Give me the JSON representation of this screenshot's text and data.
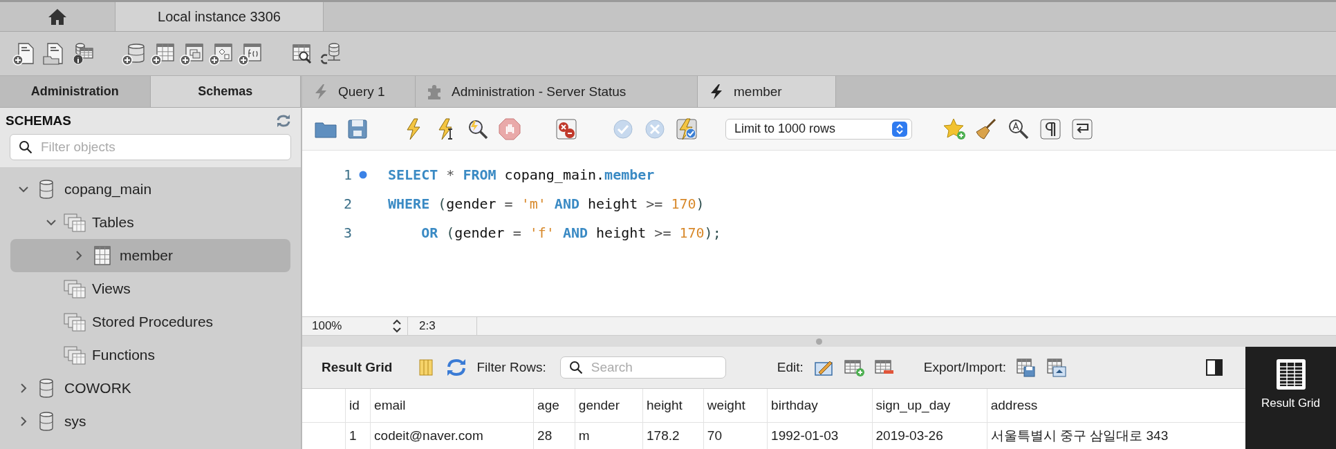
{
  "top_tabs": [
    {
      "kind": "home",
      "selected": false
    },
    {
      "kind": "connection",
      "label": "Local instance 3306",
      "selected": true
    }
  ],
  "sidebar": {
    "tabs": [
      {
        "label": "Administration",
        "selected": false
      },
      {
        "label": "Schemas",
        "selected": true
      }
    ],
    "header": "SCHEMAS",
    "filter": {
      "placeholder": "Filter objects"
    },
    "tree": [
      {
        "kind": "schema",
        "label": "copang_main",
        "expanded": true,
        "selected": false,
        "children": [
          {
            "kind": "folder",
            "label": "Tables",
            "expanded": true,
            "selected": false,
            "children": [
              {
                "kind": "table",
                "label": "member",
                "expanded": false,
                "selected": true
              }
            ]
          },
          {
            "kind": "folder",
            "label": "Views",
            "selected": false
          },
          {
            "kind": "folder",
            "label": "Stored Procedures",
            "selected": false
          },
          {
            "kind": "folder",
            "label": "Functions",
            "selected": false
          }
        ]
      },
      {
        "kind": "schema",
        "label": "COWORK",
        "expanded": false,
        "selected": false
      },
      {
        "kind": "schema",
        "label": "sys",
        "expanded": false,
        "selected": false
      }
    ]
  },
  "editor": {
    "tabs": [
      {
        "kind": "query",
        "label": "Query 1",
        "selected": false
      },
      {
        "kind": "admin",
        "label": "Administration - Server Status",
        "selected": false
      },
      {
        "kind": "query",
        "label": "member",
        "selected": true
      }
    ],
    "limit_select": {
      "value": "Limit to 1000 rows"
    },
    "lines": [
      {
        "number": "1",
        "marker": true,
        "tokens": [
          {
            "text": "SELECT",
            "kind": "keyword"
          },
          {
            "text": " * ",
            "kind": "operator"
          },
          {
            "text": "FROM",
            "kind": "keyword"
          },
          {
            "text": " copang_main.",
            "kind": "plain"
          },
          {
            "text": "member",
            "kind": "identifier"
          }
        ]
      },
      {
        "number": "2",
        "marker": false,
        "tokens": [
          {
            "text": "WHERE",
            "kind": "keyword"
          },
          {
            "text": " (",
            "kind": "punct"
          },
          {
            "text": "gender",
            "kind": "plain"
          },
          {
            "text": " = ",
            "kind": "operator"
          },
          {
            "text": "'m'",
            "kind": "string"
          },
          {
            "text": " AND",
            "kind": "keyword"
          },
          {
            "text": " height ",
            "kind": "plain"
          },
          {
            "text": ">= ",
            "kind": "operator"
          },
          {
            "text": "170",
            "kind": "number"
          },
          {
            "text": ")",
            "kind": "punct"
          }
        ]
      },
      {
        "number": "3",
        "marker": false,
        "tokens": [
          {
            "text": "    OR",
            "kind": "keyword"
          },
          {
            "text": " (",
            "kind": "punct"
          },
          {
            "text": "gender",
            "kind": "plain"
          },
          {
            "text": " = ",
            "kind": "operator"
          },
          {
            "text": "'f'",
            "kind": "string"
          },
          {
            "text": " AND",
            "kind": "keyword"
          },
          {
            "text": " height ",
            "kind": "plain"
          },
          {
            "text": ">= ",
            "kind": "operator"
          },
          {
            "text": "170",
            "kind": "number"
          },
          {
            "text": ");",
            "kind": "punct"
          }
        ]
      }
    ],
    "status": {
      "zoom": "100%",
      "position": "2:3"
    }
  },
  "results": {
    "title": "Result Grid",
    "filter_label": "Filter Rows:",
    "search": {
      "placeholder": "Search"
    },
    "edit_label": "Edit:",
    "export_label": "Export/Import:",
    "columns": [
      "id",
      "email",
      "age",
      "gender",
      "height",
      "weight",
      "birthday",
      "sign_up_day",
      "address"
    ],
    "rows": [
      [
        "1",
        "codeit@naver.com",
        "28",
        "m",
        "178.2",
        "70",
        "1992-01-03",
        "2019-03-26",
        "서울특별시 중구 삼일대로 343"
      ]
    ],
    "side_tab": {
      "label": "Result Grid",
      "selected": true
    }
  }
}
